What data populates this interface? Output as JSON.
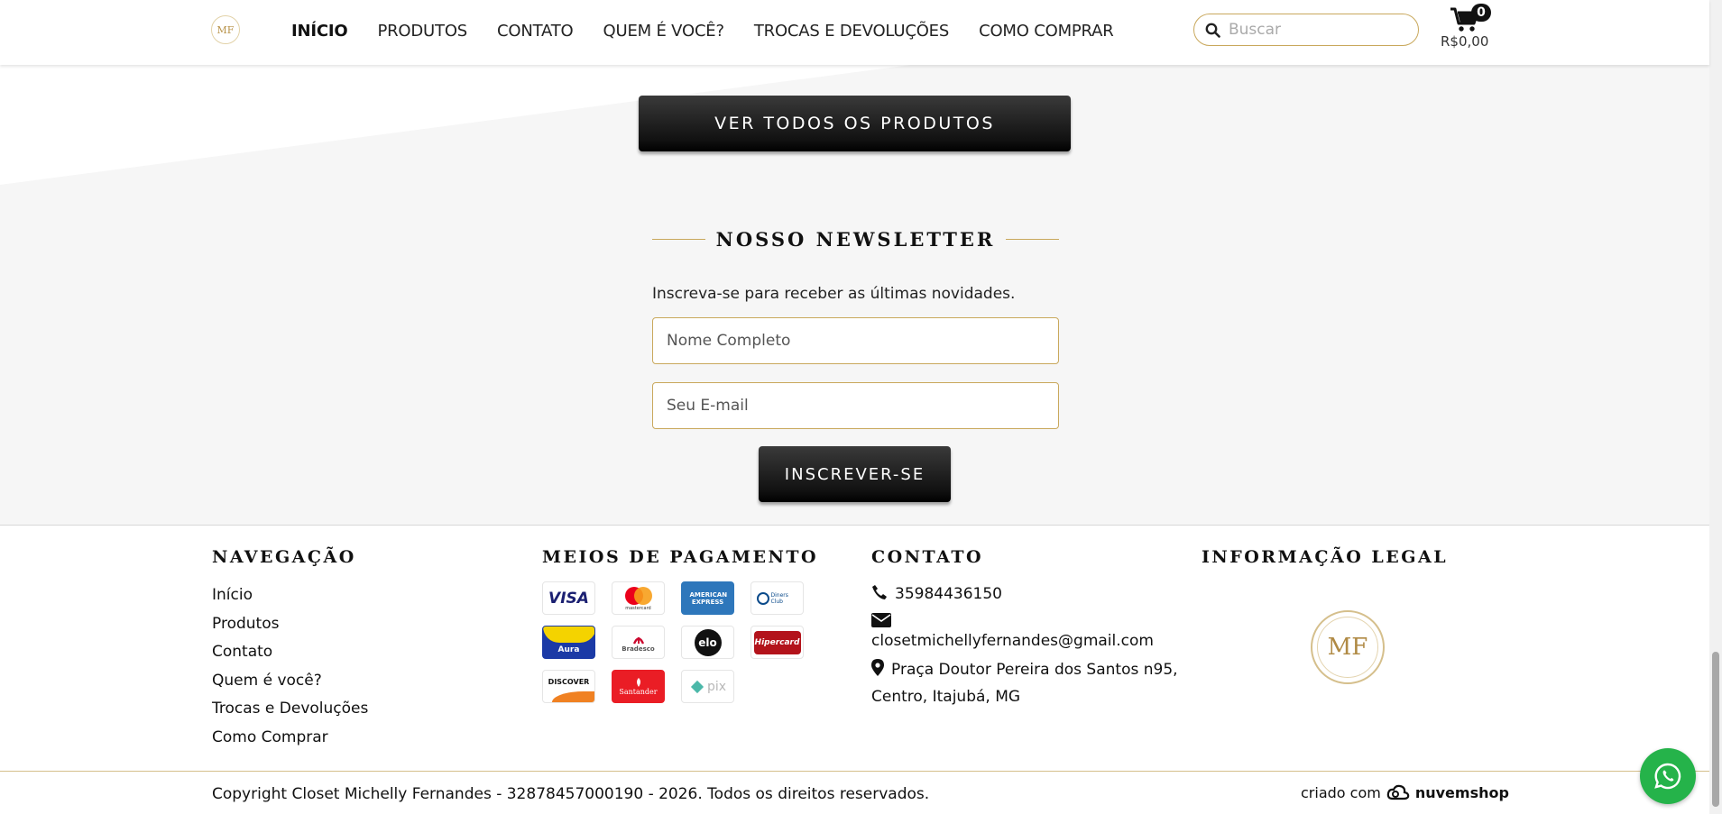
{
  "header": {
    "logo_text": "MF",
    "nav": [
      "INÍCIO",
      "PRODUTOS",
      "CONTATO",
      "QUEM É VOCÊ?",
      "TROCAS E DEVOLUÇÕES",
      "COMO COMPRAR"
    ],
    "active_nav": "INÍCIO",
    "search_placeholder": "Buscar",
    "cart_count": "0",
    "cart_total": "R$0,00"
  },
  "banner": {
    "view_all_label": "VER TODOS OS PRODUTOS"
  },
  "newsletter": {
    "title": "NOSSO NEWSLETTER",
    "description": "Inscreva-se para receber as últimas novidades.",
    "name_placeholder": "Nome Completo",
    "email_placeholder": "Seu E-mail",
    "subscribe_label": "INSCREVER-SE"
  },
  "footer": {
    "navigation": {
      "title": "NAVEGAÇÃO",
      "links": [
        "Início",
        "Produtos",
        "Contato",
        "Quem é você?",
        "Trocas e Devoluções",
        "Como Comprar"
      ]
    },
    "payment": {
      "title": "MEIOS DE PAGAMENTO",
      "methods": [
        "VISA",
        "mastercard",
        "AMERICAN EXPRESS",
        "Diners Club",
        "Aura",
        "Bradesco",
        "elo",
        "Hipercard",
        "DISCOVER",
        "Santander",
        "pix"
      ]
    },
    "contact": {
      "title": "CONTATO",
      "phone": "35984436150",
      "email": "closetmichellyfernandes@gmail.com",
      "address": "Praça Doutor Pereira dos Santos n95, Centro, Itajubá, MG"
    },
    "legal": {
      "title": "INFORMAÇÃO LEGAL",
      "logo_text": "MF"
    },
    "copyright": "Copyright Closet Michelly Fernandes - 32878457000190 - 2026. Todos os direitos reservados.",
    "made_by_prefix": "criado com",
    "made_by_brand": "nuvemshop"
  },
  "colors": {
    "accent_gold": "#c9a85c",
    "button_dark": "#111111",
    "whatsapp_green": "#25b34a"
  },
  "icons": [
    "search-icon",
    "cart-icon",
    "phone-icon",
    "envelope-icon",
    "map-pin-icon",
    "whatsapp-icon",
    "nuvemshop-logo-icon"
  ]
}
